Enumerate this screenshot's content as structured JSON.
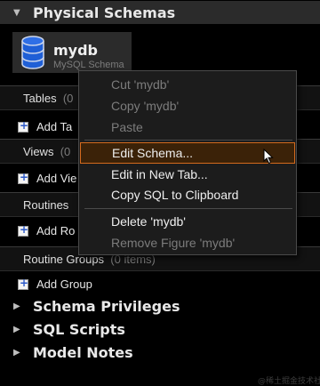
{
  "sections": {
    "physical": "Physical Schemas",
    "privileges": "Schema Privileges",
    "scripts": "SQL Scripts",
    "notes": "Model Notes"
  },
  "schema": {
    "name": "mydb",
    "type": "MySQL Schema"
  },
  "categories": {
    "tables": {
      "label": "Tables",
      "count": "(0"
    },
    "views": {
      "label": "Views",
      "count": "(0"
    },
    "routines": {
      "label": "Routines"
    },
    "routine_groups": {
      "label": "Routine Groups",
      "count": "(0 items)"
    }
  },
  "add_actions": {
    "table": "Add Ta",
    "view": "Add Vie",
    "routine": "Add Ro",
    "group": "Add Group"
  },
  "context_menu": {
    "items": [
      {
        "label": "Cut 'mydb'",
        "enabled": false
      },
      {
        "label": "Copy 'mydb'",
        "enabled": false
      },
      {
        "label": "Paste",
        "enabled": false
      },
      {
        "label": "Edit Schema...",
        "enabled": true,
        "highlighted": true
      },
      {
        "label": "Edit in New Tab...",
        "enabled": true
      },
      {
        "label": "Copy SQL to Clipboard",
        "enabled": true
      },
      {
        "label": "Delete 'mydb'",
        "enabled": true
      },
      {
        "label": "Remove Figure 'mydb'",
        "enabled": false
      }
    ]
  },
  "watermark": "@稀土掘金技术社区",
  "colors": {
    "highlight_border": "#d46a1d",
    "highlight_bg": "#3b2208",
    "disabled_text": "#7c7c7c"
  }
}
